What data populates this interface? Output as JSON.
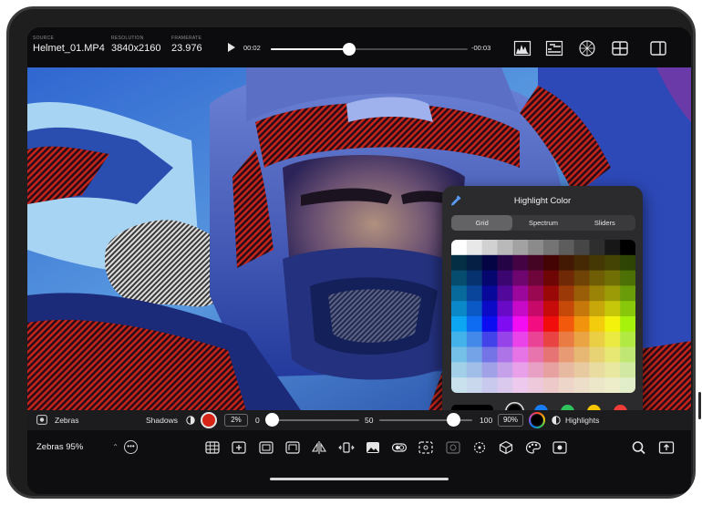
{
  "clip": {
    "source_label": "SOURCE",
    "source_value": "Helmet_01.MP4",
    "resolution_label": "RESOLUTION",
    "resolution_value": "3840x2160",
    "framerate_label": "FRAMERATE",
    "framerate_value": "23.976"
  },
  "playback": {
    "elapsed": "00:02",
    "remaining": "-00:03",
    "progress": 0.4
  },
  "top_icons": [
    "histogram-icon",
    "waveform-icon",
    "vectorscope-icon",
    "grid-layout-icon",
    "sidebar-icon"
  ],
  "color_picker": {
    "title": "Highlight Color",
    "tabs": [
      "Grid",
      "Spectrum",
      "Sliders"
    ],
    "active_tab": "Grid",
    "selected_color": "#000000",
    "preset_colors": [
      "#000000",
      "#1a7cf5",
      "#2fc15b",
      "#f7c600",
      "#f23c3a"
    ]
  },
  "zebras": {
    "label": "Zebras",
    "shadows_label": "Shadows",
    "shadow_color": "#d62416",
    "shadow_percent": "2%",
    "range_min": "0",
    "range_mid": "50",
    "range_max": "100",
    "low_value": 0.02,
    "high_value": 0.9,
    "highlight_percent": "90%",
    "highlights_label": "Highlights"
  },
  "toolbar": {
    "preset_label": "Zebras 95%",
    "tools": [
      "grid-icon",
      "crosshair-icon",
      "frame-icon",
      "safe-area-icon",
      "flip-icon",
      "anamorphic-icon",
      "image-icon",
      "false-color-icon",
      "focus-peaking-icon",
      "disabled-icon",
      "hdr-icon",
      "cube-lut-icon",
      "palette-icon",
      "zebra-overlay-icon"
    ],
    "right_tools": [
      "search-icon",
      "screen-share-icon"
    ]
  }
}
